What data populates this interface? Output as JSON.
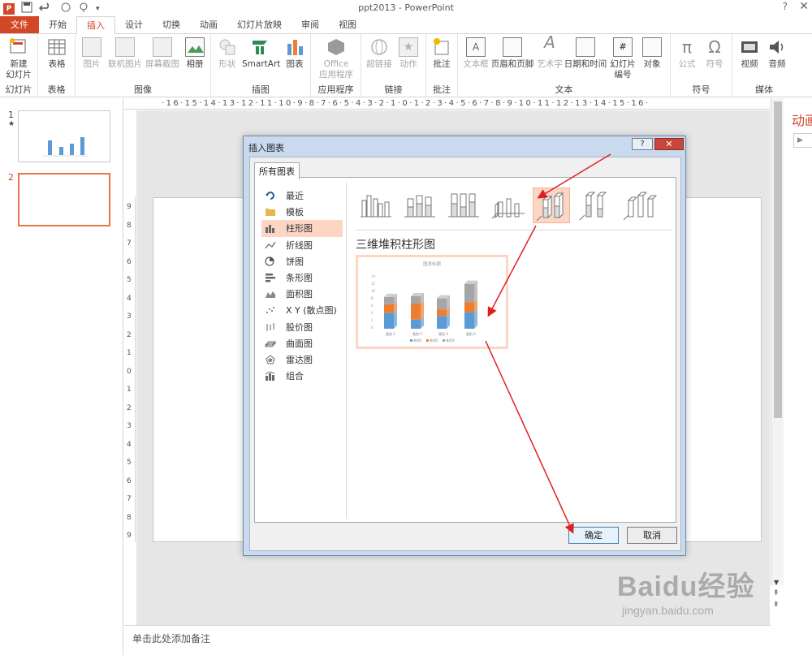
{
  "window": {
    "title": "ppt2013 - PowerPoint",
    "help_icon": "?",
    "close_icon": "✕"
  },
  "qat": [
    "save-icon",
    "undo-icon",
    "redo-icon",
    "touch-mode-icon",
    "customize-icon"
  ],
  "tabs": [
    {
      "label": "文件",
      "active": false,
      "file": true
    },
    {
      "label": "开始",
      "active": false
    },
    {
      "label": "插入",
      "active": true
    },
    {
      "label": "设计",
      "active": false
    },
    {
      "label": "切换",
      "active": false
    },
    {
      "label": "动画",
      "active": false
    },
    {
      "label": "幻灯片放映",
      "active": false
    },
    {
      "label": "审阅",
      "active": false
    },
    {
      "label": "视图",
      "active": false
    }
  ],
  "ribbon": {
    "groups": {
      "slides": "幻灯片",
      "tables": "表格",
      "images": "图像",
      "illustrations": "插图",
      "apps": "应用程序",
      "links": "链接",
      "comments": "批注",
      "text": "文本",
      "symbols": "符号",
      "media": "媒体"
    },
    "buttons": {
      "new_slide": "新建\n幻灯片",
      "table": "表格",
      "picture": "图片",
      "online_picture": "联机图片",
      "screenshot": "屏幕截图",
      "album": "相册",
      "shapes": "形状",
      "smartart": "SmartArt",
      "chart": "图表",
      "office_apps": "Office\n应用程序",
      "hyperlink": "超链接",
      "action": "动作",
      "comment": "批注",
      "textbox": "文本框",
      "header_footer": "页眉和页脚",
      "wordart": "艺术字",
      "datetime": "日期和时间",
      "slide_number": "幻灯片\n编号",
      "object": "对象",
      "equation": "公式",
      "symbol": "符号",
      "video": "视频",
      "audio": "音频"
    }
  },
  "slides": [
    {
      "number": "1",
      "star": "★"
    },
    {
      "number": "2"
    }
  ],
  "ruler": {
    "h": "·16·15·14·13·12·11·10·9·8·7·6·5·4·3·2·1·0·1·2·3·4·5·6·7·8·9·10·11·12·13·14·15·16·",
    "v": [
      "9",
      "8",
      "7",
      "6",
      "5",
      "4",
      "3",
      "2",
      "1",
      "0",
      "1",
      "2",
      "3",
      "4",
      "5",
      "6",
      "7",
      "8",
      "9"
    ]
  },
  "notes_placeholder": "单击此处添加备注",
  "right_pane_title": "动画",
  "dialog": {
    "title": "插入图表",
    "tab": "所有图表",
    "categories": [
      {
        "label": "最近",
        "icon": "recent-icon"
      },
      {
        "label": "模板",
        "icon": "folder-icon"
      },
      {
        "label": "柱形图",
        "icon": "column-chart-icon",
        "selected": true
      },
      {
        "label": "折线图",
        "icon": "line-chart-icon"
      },
      {
        "label": "饼图",
        "icon": "pie-chart-icon"
      },
      {
        "label": "条形图",
        "icon": "bar-chart-icon"
      },
      {
        "label": "面积图",
        "icon": "area-chart-icon"
      },
      {
        "label": "X Y (散点图)",
        "icon": "scatter-chart-icon"
      },
      {
        "label": "股价图",
        "icon": "stock-chart-icon"
      },
      {
        "label": "曲面图",
        "icon": "surface-chart-icon"
      },
      {
        "label": "雷达图",
        "icon": "radar-chart-icon"
      },
      {
        "label": "组合",
        "icon": "combo-chart-icon"
      }
    ],
    "chart_types_selected_index": 4,
    "selected_type_title": "三维堆积柱形图",
    "preview": {
      "title": "图表标题",
      "categories": [
        "类别 1",
        "类别 2",
        "类别 3",
        "类别 4"
      ],
      "legend": [
        "系列1",
        "系列2",
        "系列3"
      ],
      "colors": [
        "#5b9bd5",
        "#ed7d31",
        "#a5a5a5"
      ]
    },
    "ok": "确定",
    "cancel": "取消"
  },
  "watermark": {
    "brand": "Baidu经验",
    "url": "jingyan.baidu.com"
  }
}
